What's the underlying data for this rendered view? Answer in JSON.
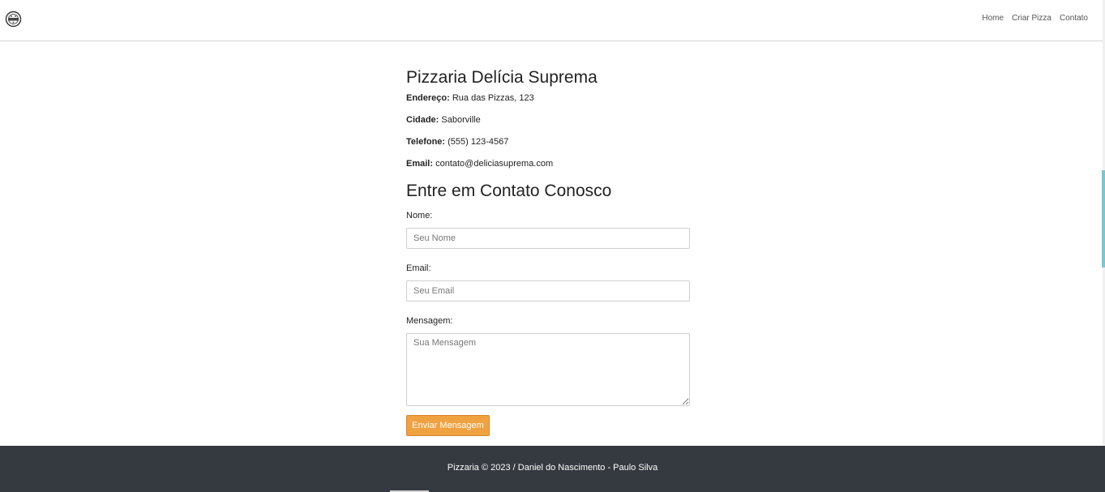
{
  "brand": {
    "logo_icon": "pizza-logo-icon"
  },
  "nav": {
    "items": [
      {
        "label": "Home"
      },
      {
        "label": "Criar Pizza"
      },
      {
        "label": "Contato"
      }
    ]
  },
  "pizzeria": {
    "name": "Pizzaria Delícia Suprema",
    "address_label": "Endereço:",
    "address": "Rua das Pizzas, 123",
    "city_label": "Cidade:",
    "city": "Saborville",
    "phone_label": "Telefone:",
    "phone": "(555) 123-4567",
    "email_label": "Email:",
    "email": "contato@deliciasuprema.com"
  },
  "contact_form": {
    "title": "Entre em Contato Conosco",
    "name_label": "Nome:",
    "name_placeholder": "Seu Nome",
    "email_label": "Email:",
    "email_placeholder": "Seu Email",
    "message_label": "Mensagem:",
    "message_placeholder": "Sua Mensagem",
    "submit_label": "Enviar Mensagem"
  },
  "footer": {
    "text": "Pizzaria © 2023 / Daniel do Nascimento - Paulo Silva"
  },
  "colors": {
    "accent_button": "#f0a140",
    "footer_bg": "#343a40"
  }
}
